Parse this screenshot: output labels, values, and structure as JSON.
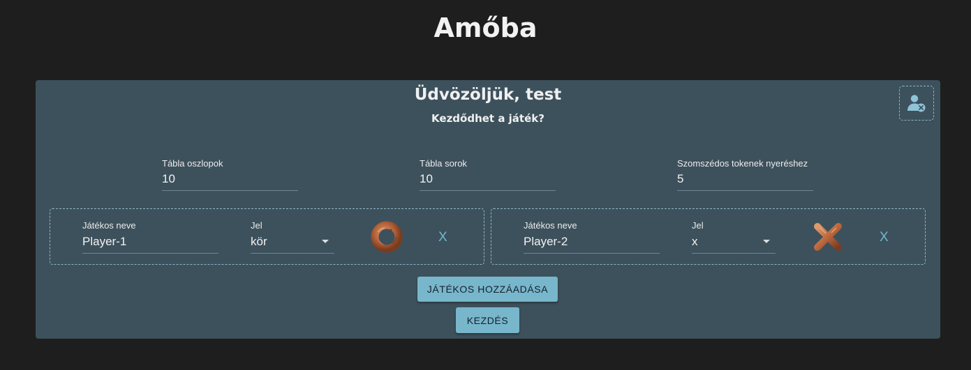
{
  "app": {
    "title": "Amőba"
  },
  "welcome": {
    "title": "Üdvözöljük, test",
    "subtitle": "Kezdődhet a játék?"
  },
  "logout": {
    "icon": "user-remove-icon"
  },
  "settings": {
    "columns": {
      "label": "Tábla oszlopok",
      "value": "10"
    },
    "rows": {
      "label": "Tábla sorok",
      "value": "10"
    },
    "to_win": {
      "label": "Szomszédos tokenek nyeréshez",
      "value": "5"
    }
  },
  "players": [
    {
      "name_label": "Játékos neve",
      "name": "Player-1",
      "symbol_label": "Jel",
      "symbol": "kör",
      "token_icon": "wooden-ring-icon",
      "remove_label": "X"
    },
    {
      "name_label": "Játékos neve",
      "name": "Player-2",
      "symbol_label": "Jel",
      "symbol": "x",
      "token_icon": "wooden-cross-icon",
      "remove_label": "X"
    }
  ],
  "buttons": {
    "add_player": "JÁTÉKOS HOZZÁADÁSA",
    "start": "KEZDÉS"
  },
  "colors": {
    "background": "#1e1e1e",
    "card": "#3d515c",
    "accent": "#78b6cc",
    "wood": "#b5623a"
  }
}
